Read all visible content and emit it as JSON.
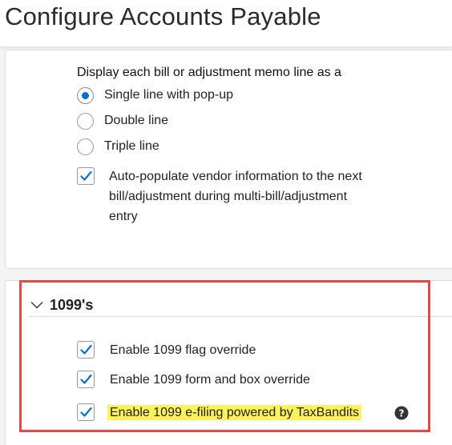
{
  "page": {
    "title": "Configure Accounts Payable"
  },
  "memo_display": {
    "heading": "Display each bill or adjustment memo line as a",
    "options": [
      {
        "label": "Single line with pop-up",
        "selected": true
      },
      {
        "label": "Double line",
        "selected": false
      },
      {
        "label": "Triple line",
        "selected": false
      }
    ]
  },
  "auto_populate": {
    "checked": true,
    "line1": "Auto-populate vendor information to the next",
    "line2": "bill/adjustment during multi-bill/adjustment",
    "line3": "entry"
  },
  "section_1099": {
    "title": "1099's",
    "options": [
      {
        "label": "Enable 1099 flag override",
        "checked": true
      },
      {
        "label": "Enable 1099 form and box override",
        "checked": true
      },
      {
        "label": "Enable 1099 e-filing powered by TaxBandits",
        "checked": true,
        "highlighted": true
      }
    ]
  },
  "colors": {
    "accent": "#0a6fc2",
    "highlight": "#fff25a",
    "annotation_box": "#e04a4a"
  },
  "icons": {
    "section_toggle": "chevron-down-icon",
    "help": "help-circle-icon",
    "check": "checkmark-icon"
  }
}
